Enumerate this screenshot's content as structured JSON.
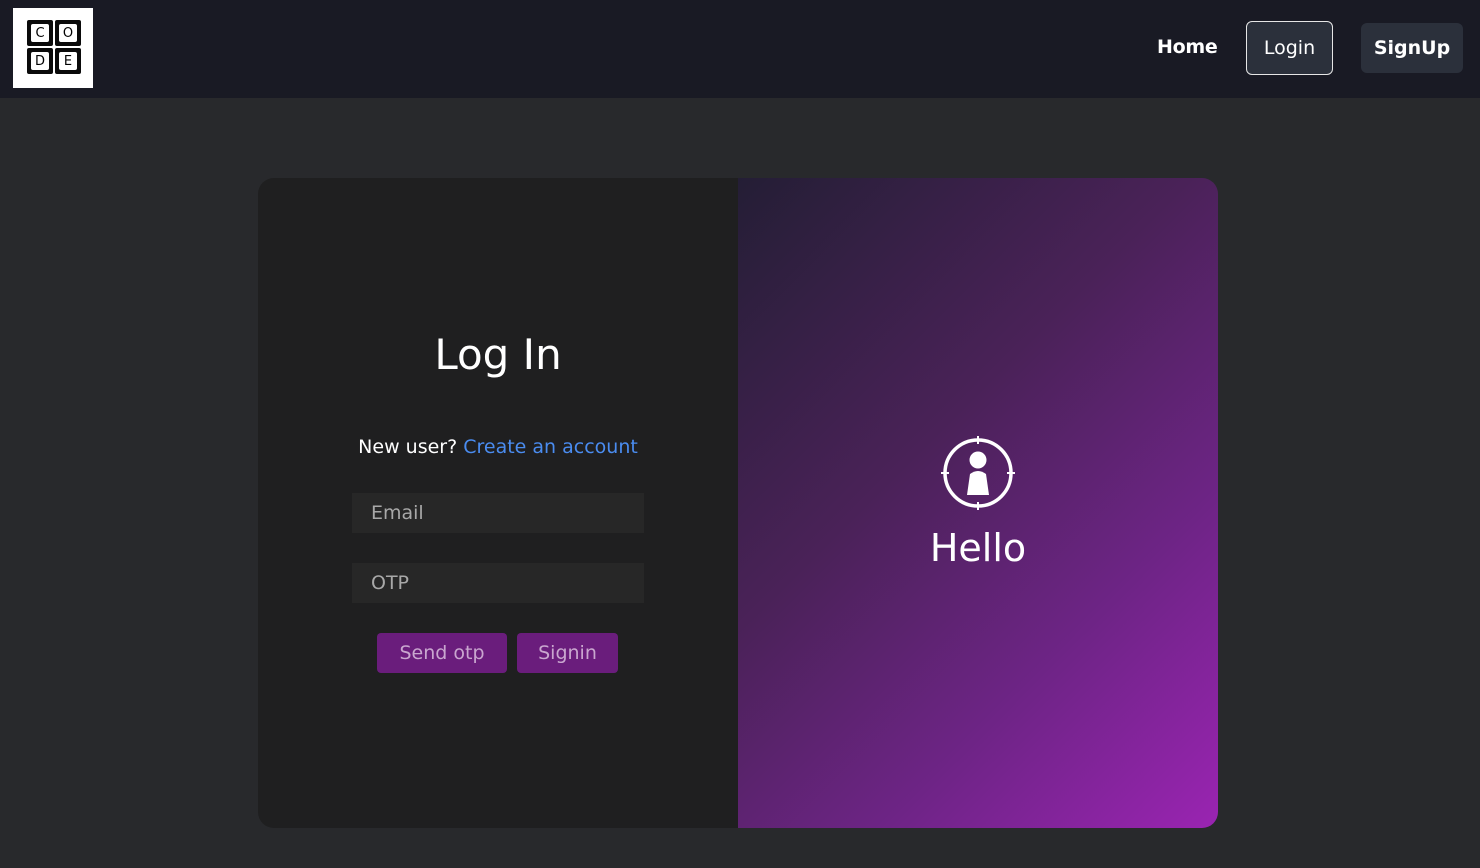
{
  "header": {
    "logo_letters": [
      "C",
      "O",
      "D",
      "E"
    ],
    "nav": {
      "home": "Home",
      "login": "Login",
      "signup": "SignUp"
    }
  },
  "login_panel": {
    "title": "Log In",
    "new_user_prompt": "New user?",
    "create_account_link": "Create an account",
    "email_placeholder": "Email",
    "otp_placeholder": "OTP",
    "send_otp_label": "Send otp",
    "signin_label": "Signin"
  },
  "welcome_panel": {
    "icon": "user-target-icon",
    "greeting": "Hello"
  },
  "colors": {
    "nav_bg": "#191a24",
    "page_bg": "#28292c",
    "accent_purple": "#6a1d7c",
    "link_blue": "#4a8cf0"
  }
}
